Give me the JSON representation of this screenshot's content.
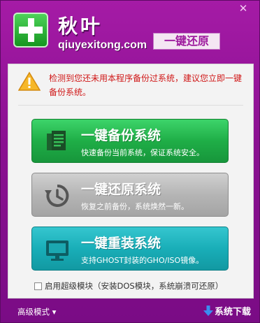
{
  "window": {
    "close_label": "✕"
  },
  "header": {
    "brand": "秋叶",
    "domain": "qiuyexitong.com",
    "badge": "一键还原"
  },
  "notice": {
    "text": "检测到您还未用本程序备份过系统，建议您立即一键备份系统。"
  },
  "actions": [
    {
      "title": "一键备份系统",
      "subtitle": "快速备份当前系统，保证系统安全。",
      "color": "#23b64c"
    },
    {
      "title": "一键还原系统",
      "subtitle": "恢复之前备份，系统焕然一新。",
      "color": "#b5b5b5"
    },
    {
      "title": "一键重装系统",
      "subtitle": "支持GHOST封装的GHO/ISO镜像。",
      "color": "#19aeb8"
    }
  ],
  "option": {
    "label": "启用超级模块（安装DOS模块，系统崩溃可还原）",
    "checked": false
  },
  "footer": {
    "advanced_label": "高级模式",
    "download_label": "系统下载"
  },
  "colors": {
    "window_bg": "#8a1091",
    "warning_text": "#d01818",
    "panel_bg": "#f3f3f3"
  }
}
